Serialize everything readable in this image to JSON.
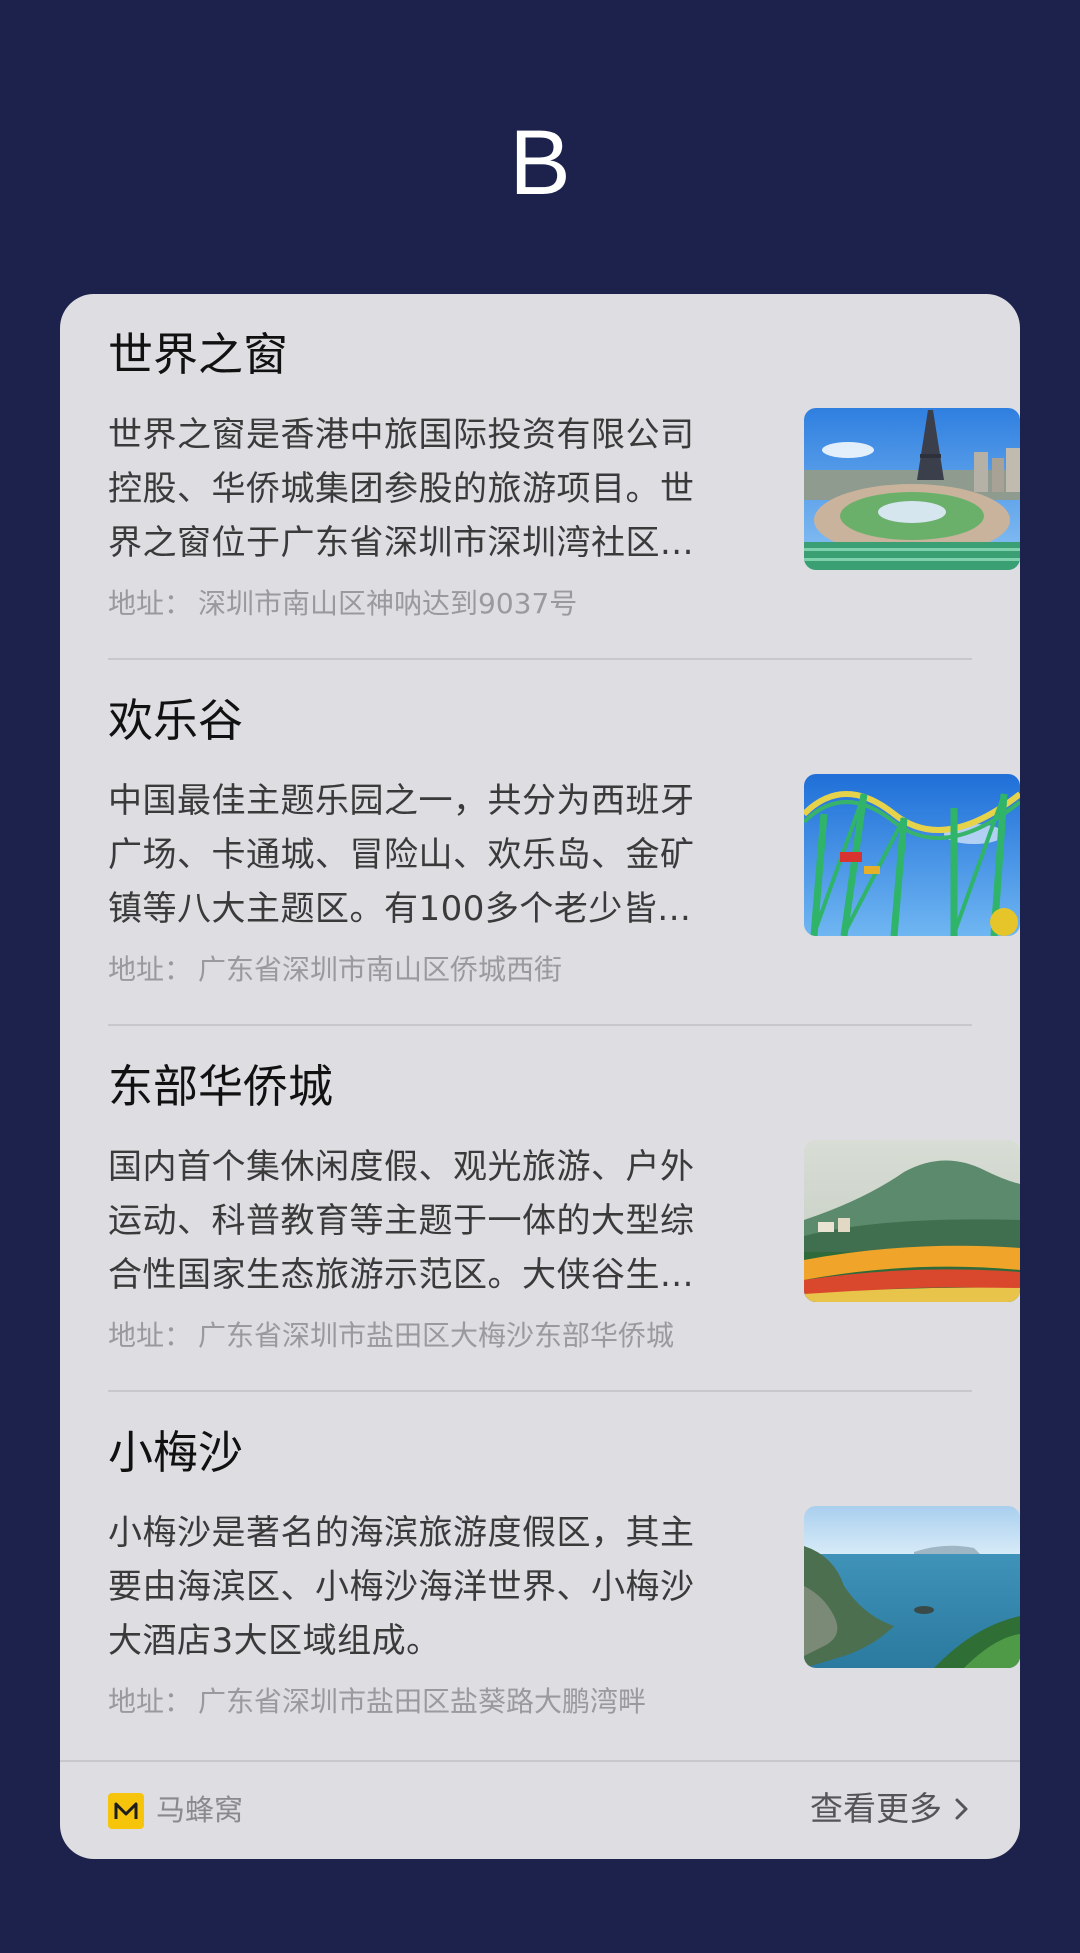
{
  "header": {
    "letter": "B"
  },
  "card": {
    "items": [
      {
        "title": "世界之窗",
        "description": "世界之窗是香港中旅国际投资有限公司控股、华侨城集团参股的旅游项目。世界之窗位于广东省深圳市深圳湾社区...",
        "address_label": "地址：",
        "address": "深圳市南山区神呐达到9037号",
        "image_icon": "eiffel-tower-park-photo"
      },
      {
        "title": "欢乐谷",
        "description": "中国最佳主题乐园之一，共分为西班牙广场、卡通城、冒险山、欢乐岛、金矿镇等八大主题区。有100多个老少皆...",
        "address_label": "地址：",
        "address": "广东省深圳市南山区侨城西街",
        "image_icon": "roller-coaster-photo"
      },
      {
        "title": "东部华侨城",
        "description": "国内首个集休闲度假、观光旅游、户外运动、科普教育等主题于一体的大型综合性国家生态旅游示范区。大侠谷生...",
        "address_label": "地址：",
        "address": "广东省深圳市盐田区大梅沙东部华侨城",
        "image_icon": "mountain-flowers-photo"
      },
      {
        "title": "小梅沙",
        "description": "小梅沙是著名的海滨旅游度假区，其主要由海滨区、小梅沙海洋世界、小梅沙大酒店3大区域组成。",
        "address_label": "地址：",
        "address": "广东省深圳市盐田区盐葵路大鹏湾畔",
        "image_icon": "seaside-coast-photo"
      }
    ]
  },
  "footer": {
    "brand_name": "马蜂窝",
    "brand_icon": "mafengwo-logo-icon",
    "more_label": "查看更多",
    "more_icon": "chevron-right-icon"
  },
  "colors": {
    "background": "#1d224c",
    "card": "#dddde2",
    "brand_yellow": "#f6c40a"
  }
}
